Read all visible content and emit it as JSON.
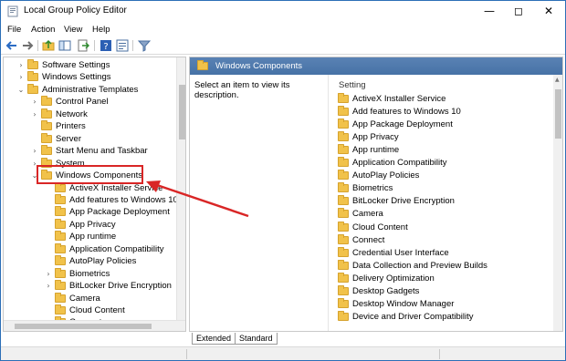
{
  "window": {
    "title": "Local Group Policy Editor"
  },
  "menu": [
    "File",
    "Action",
    "View",
    "Help"
  ],
  "tree": [
    {
      "label": "Software Settings",
      "twisty": "›"
    },
    {
      "label": "Windows Settings",
      "twisty": "›"
    },
    {
      "label": "Administrative Templates",
      "twisty": "⌄"
    },
    {
      "label": "Control Panel",
      "twisty": "›"
    },
    {
      "label": "Network",
      "twisty": "›"
    },
    {
      "label": "Printers",
      "twisty": ""
    },
    {
      "label": "Server",
      "twisty": ""
    },
    {
      "label": "Start Menu and Taskbar",
      "twisty": "›"
    },
    {
      "label": "System",
      "twisty": "›"
    },
    {
      "label": "Windows Components",
      "twisty": "⌄"
    },
    {
      "label": "ActiveX Installer Service",
      "twisty": ""
    },
    {
      "label": "Add features to Windows 10",
      "twisty": ""
    },
    {
      "label": "App Package Deployment",
      "twisty": ""
    },
    {
      "label": "App Privacy",
      "twisty": ""
    },
    {
      "label": "App runtime",
      "twisty": ""
    },
    {
      "label": "Application Compatibility",
      "twisty": ""
    },
    {
      "label": "AutoPlay Policies",
      "twisty": ""
    },
    {
      "label": "Biometrics",
      "twisty": "›"
    },
    {
      "label": "BitLocker Drive Encryption",
      "twisty": "›"
    },
    {
      "label": "Camera",
      "twisty": ""
    },
    {
      "label": "Cloud Content",
      "twisty": ""
    },
    {
      "label": "Connect",
      "twisty": ""
    },
    {
      "label": "Credential User Interface",
      "twisty": ""
    }
  ],
  "right": {
    "header": "Windows Components",
    "description": "Select an item to view its description.",
    "setting_header": "Setting",
    "settings": [
      "ActiveX Installer Service",
      "Add features to Windows 10",
      "App Package Deployment",
      "App Privacy",
      "App runtime",
      "Application Compatibility",
      "AutoPlay Policies",
      "Biometrics",
      "BitLocker Drive Encryption",
      "Camera",
      "Cloud Content",
      "Connect",
      "Credential User Interface",
      "Data Collection and Preview Builds",
      "Delivery Optimization",
      "Desktop Gadgets",
      "Desktop Window Manager",
      "Device and Driver Compatibility"
    ]
  },
  "tabs": {
    "extended": "Extended",
    "standard": "Standard"
  },
  "annotation": {
    "color": "#d92626"
  }
}
